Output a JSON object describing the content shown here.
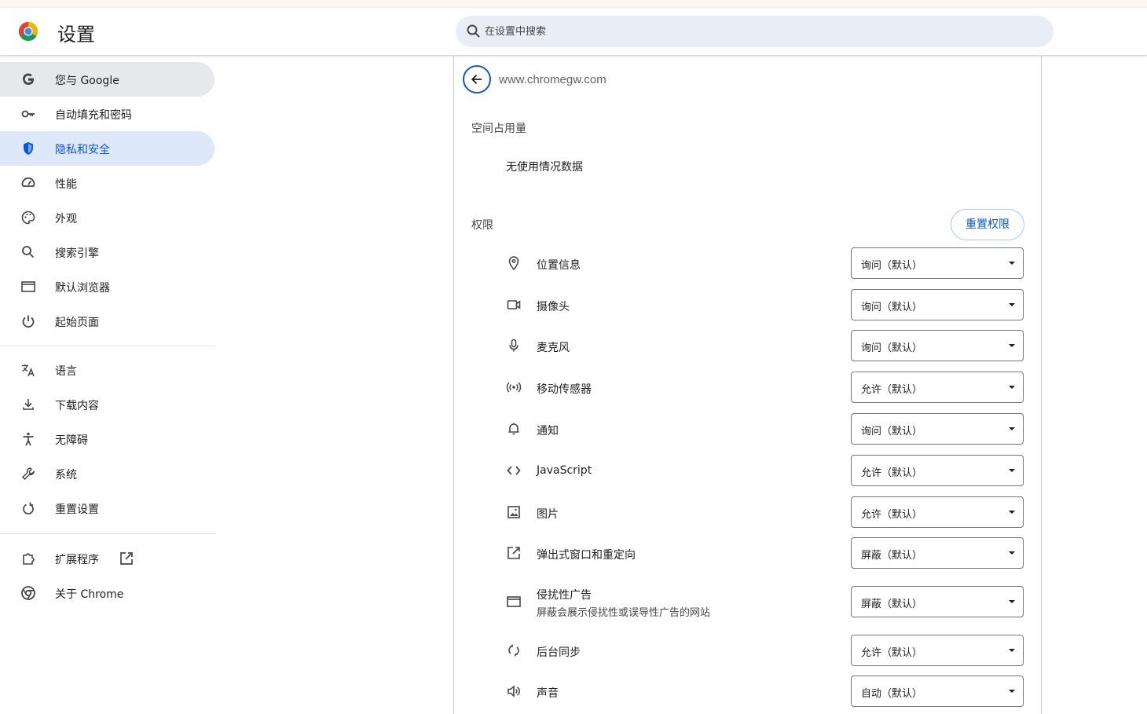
{
  "header": {
    "title": "设置",
    "search_placeholder": "在设置中搜索"
  },
  "sidebar": {
    "items": [
      {
        "label": "您与 Google",
        "icon": "google-g-icon"
      },
      {
        "label": "自动填充和密码",
        "icon": "key-icon"
      },
      {
        "label": "隐私和安全",
        "icon": "shield-icon"
      },
      {
        "label": "性能",
        "icon": "speedometer-icon"
      },
      {
        "label": "外观",
        "icon": "palette-icon"
      },
      {
        "label": "搜索引擎",
        "icon": "search-icon"
      },
      {
        "label": "默认浏览器",
        "icon": "browser-window-icon"
      },
      {
        "label": "起始页面",
        "icon": "power-icon"
      },
      {
        "label": "语言",
        "icon": "translate-icon"
      },
      {
        "label": "下载内容",
        "icon": "download-icon"
      },
      {
        "label": "无障碍",
        "icon": "accessibility-icon"
      },
      {
        "label": "系统",
        "icon": "wrench-icon"
      },
      {
        "label": "重置设置",
        "icon": "reset-icon"
      },
      {
        "label": "扩展程序",
        "icon": "puzzle-icon"
      },
      {
        "label": "关于 Chrome",
        "icon": "chrome-icon"
      }
    ]
  },
  "site": {
    "url": "www.chromegw.com",
    "usage_heading": "空间占用量",
    "usage_text": "无使用情况数据",
    "permissions_heading": "权限",
    "reset_button": "重置权限"
  },
  "permissions": [
    {
      "label": "位置信息",
      "value": "询问（默认）",
      "icon": "location-pin-icon"
    },
    {
      "label": "摄像头",
      "value": "询问（默认）",
      "icon": "camera-icon"
    },
    {
      "label": "麦克风",
      "value": "询问（默认）",
      "icon": "microphone-icon"
    },
    {
      "label": "移动传感器",
      "value": "允许（默认）",
      "icon": "sensor-icon"
    },
    {
      "label": "通知",
      "value": "询问（默认）",
      "icon": "bell-icon"
    },
    {
      "label": "JavaScript",
      "value": "允许（默认）",
      "icon": "code-icon"
    },
    {
      "label": "图片",
      "value": "允许（默认）",
      "icon": "image-icon"
    },
    {
      "label": "弹出式窗口和重定向",
      "value": "屏蔽（默认）",
      "icon": "open-in-new-icon"
    },
    {
      "label": "侵扰性广告",
      "sub": "屏蔽会展示侵扰性或误导性广告的网站",
      "value": "屏蔽（默认）",
      "icon": "ad-window-icon"
    },
    {
      "label": "后台同步",
      "value": "允许（默认）",
      "icon": "sync-icon"
    },
    {
      "label": "声音",
      "value": "自动（默认）",
      "icon": "speaker-icon"
    }
  ],
  "colors": {
    "accent": "#0b57d0",
    "active_bg": "#dde8fa",
    "hover_bg": "#e6e8eb",
    "search_bg": "#e9eef6"
  }
}
